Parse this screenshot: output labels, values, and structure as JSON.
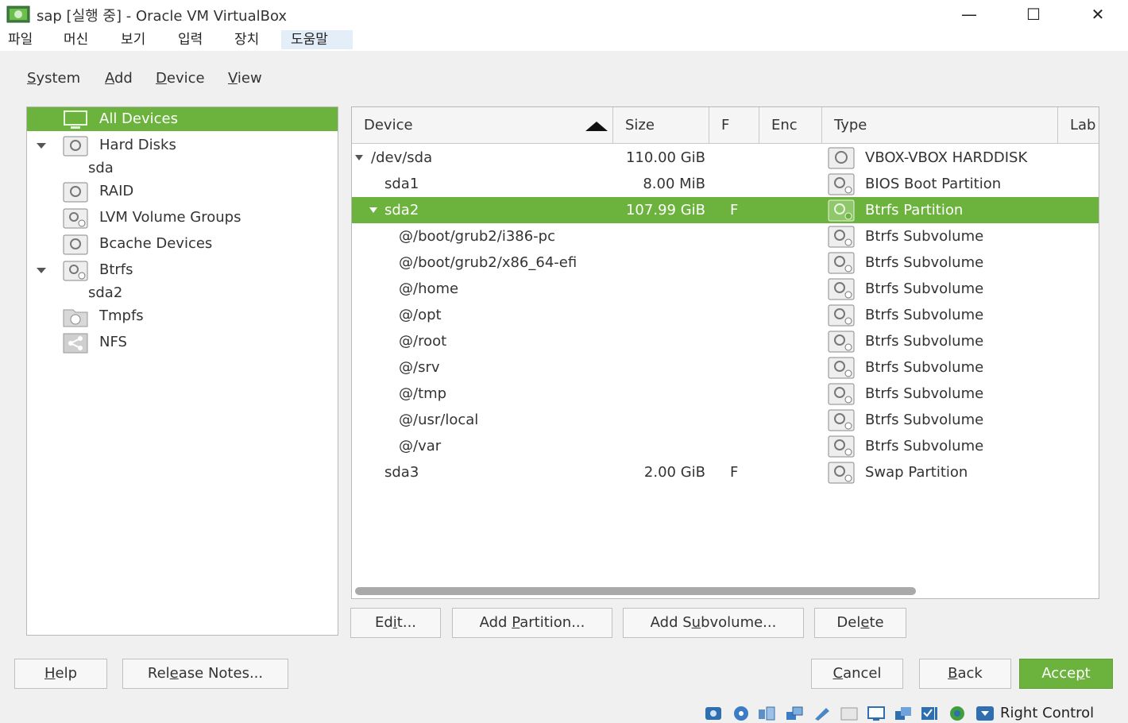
{
  "window": {
    "title": "sap [실행 중] - Oracle VM VirtualBox",
    "minimize_symbol": "—",
    "maximize_symbol": "☐",
    "close_symbol": "✕"
  },
  "host_menu": [
    "파일",
    "머신",
    "보기",
    "입력",
    "장치",
    "도움말"
  ],
  "app_menu": {
    "system": {
      "pre": "",
      "key": "S",
      "post": "ystem"
    },
    "add": {
      "pre": "",
      "key": "A",
      "post": "dd"
    },
    "device": {
      "pre": "",
      "key": "D",
      "post": "evice"
    },
    "view": {
      "pre": "",
      "key": "V",
      "post": "iew"
    }
  },
  "tree": {
    "all_devices": "All Devices",
    "hard_disks": "Hard Disks",
    "sda": "sda",
    "raid": "RAID",
    "lvm": "LVM Volume Groups",
    "bcache": "Bcache Devices",
    "btrfs": "Btrfs",
    "sda2": "sda2",
    "tmpfs": "Tmpfs",
    "nfs": "NFS"
  },
  "table": {
    "headers": {
      "device": "Device",
      "size": "Size",
      "f": "F",
      "enc": "Enc",
      "type": "Type",
      "label": "Lab"
    },
    "rows": [
      {
        "device": "/dev/sda",
        "size": "110.00 GiB",
        "f": "",
        "type": "VBOX-VBOX HARDDISK"
      },
      {
        "device": "sda1",
        "size": "8.00 MiB",
        "f": "",
        "type": "BIOS Boot Partition"
      },
      {
        "device": "sda2",
        "size": "107.99 GiB",
        "f": "F",
        "type": "Btrfs Partition"
      },
      {
        "device": "@/boot/grub2/i386-pc",
        "size": "",
        "f": "",
        "type": "Btrfs Subvolume"
      },
      {
        "device": "@/boot/grub2/x86_64-efi",
        "size": "",
        "f": "",
        "type": "Btrfs Subvolume"
      },
      {
        "device": "@/home",
        "size": "",
        "f": "",
        "type": "Btrfs Subvolume"
      },
      {
        "device": "@/opt",
        "size": "",
        "f": "",
        "type": "Btrfs Subvolume"
      },
      {
        "device": "@/root",
        "size": "",
        "f": "",
        "type": "Btrfs Subvolume"
      },
      {
        "device": "@/srv",
        "size": "",
        "f": "",
        "type": "Btrfs Subvolume"
      },
      {
        "device": "@/tmp",
        "size": "",
        "f": "",
        "type": "Btrfs Subvolume"
      },
      {
        "device": "@/usr/local",
        "size": "",
        "f": "",
        "type": "Btrfs Subvolume"
      },
      {
        "device": "@/var",
        "size": "",
        "f": "",
        "type": "Btrfs Subvolume"
      },
      {
        "device": "sda3",
        "size": "2.00 GiB",
        "f": "F",
        "type": "Swap Partition"
      }
    ]
  },
  "buttons": {
    "edit": {
      "pre": "Ed",
      "key": "i",
      "post": "t..."
    },
    "add_partition": {
      "pre": "Add ",
      "key": "P",
      "post": "artition..."
    },
    "add_subvolume": {
      "pre": "Add S",
      "key": "u",
      "post": "bvolume..."
    },
    "delete": {
      "pre": "Del",
      "key": "e",
      "post": "te"
    },
    "help": {
      "pre": "",
      "key": "H",
      "post": "elp"
    },
    "release_notes": {
      "pre": "Rel",
      "key": "e",
      "post": "ase Notes..."
    },
    "cancel": {
      "pre": "",
      "key": "C",
      "post": "ancel"
    },
    "back": {
      "pre": "",
      "key": "B",
      "post": "ack"
    },
    "accept": {
      "pre": "Acce",
      "key": "p",
      "post": "t"
    }
  },
  "status": {
    "host_key": "Right Control",
    "icons": [
      "hdd-activity-icon",
      "optical-drive-icon",
      "audio-icon",
      "network-icon",
      "usb-icon",
      "shared-folder-icon",
      "display-icon",
      "video-capture-icon",
      "vt-x-icon",
      "guest-additions-icon",
      "mouse-integration-icon"
    ]
  },
  "colors": {
    "accent": "#6cb33e",
    "guest_bg": "#f0f0f0"
  }
}
